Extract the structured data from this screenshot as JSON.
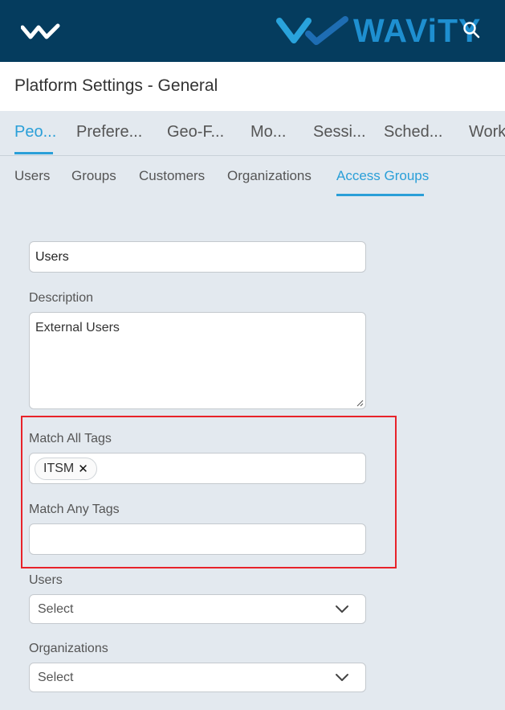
{
  "header": {
    "brand_name": "WAViTY",
    "colors": {
      "bg": "#053c5e",
      "brand": "#1e8fd0"
    },
    "icons": [
      "menu-logo-icon",
      "brand-logo-icon",
      "search-icon"
    ]
  },
  "page": {
    "title": "Platform Settings - General"
  },
  "tabs": [
    {
      "label": "Peo...",
      "active": true
    },
    {
      "label": "Prefere..."
    },
    {
      "label": "Geo-F..."
    },
    {
      "label": "Mo..."
    },
    {
      "label": "Sessi..."
    },
    {
      "label": "Sched..."
    },
    {
      "label": "Work"
    }
  ],
  "subtabs": [
    {
      "label": "Users"
    },
    {
      "label": "Groups"
    },
    {
      "label": "Customers"
    },
    {
      "label": "Organizations"
    },
    {
      "label": "Access Groups",
      "active": true
    }
  ],
  "form": {
    "name_value": "Users",
    "description_label": "Description",
    "description_value": "External Users",
    "match_all_label": "Match All Tags",
    "match_all_tags": [
      "ITSM"
    ],
    "tag_remove_glyph": "✕",
    "match_any_label": "Match Any Tags",
    "users_label": "Users",
    "users_select": "Select",
    "orgs_label": "Organizations",
    "orgs_select": "Select"
  },
  "highlight_color": "#e8232a"
}
